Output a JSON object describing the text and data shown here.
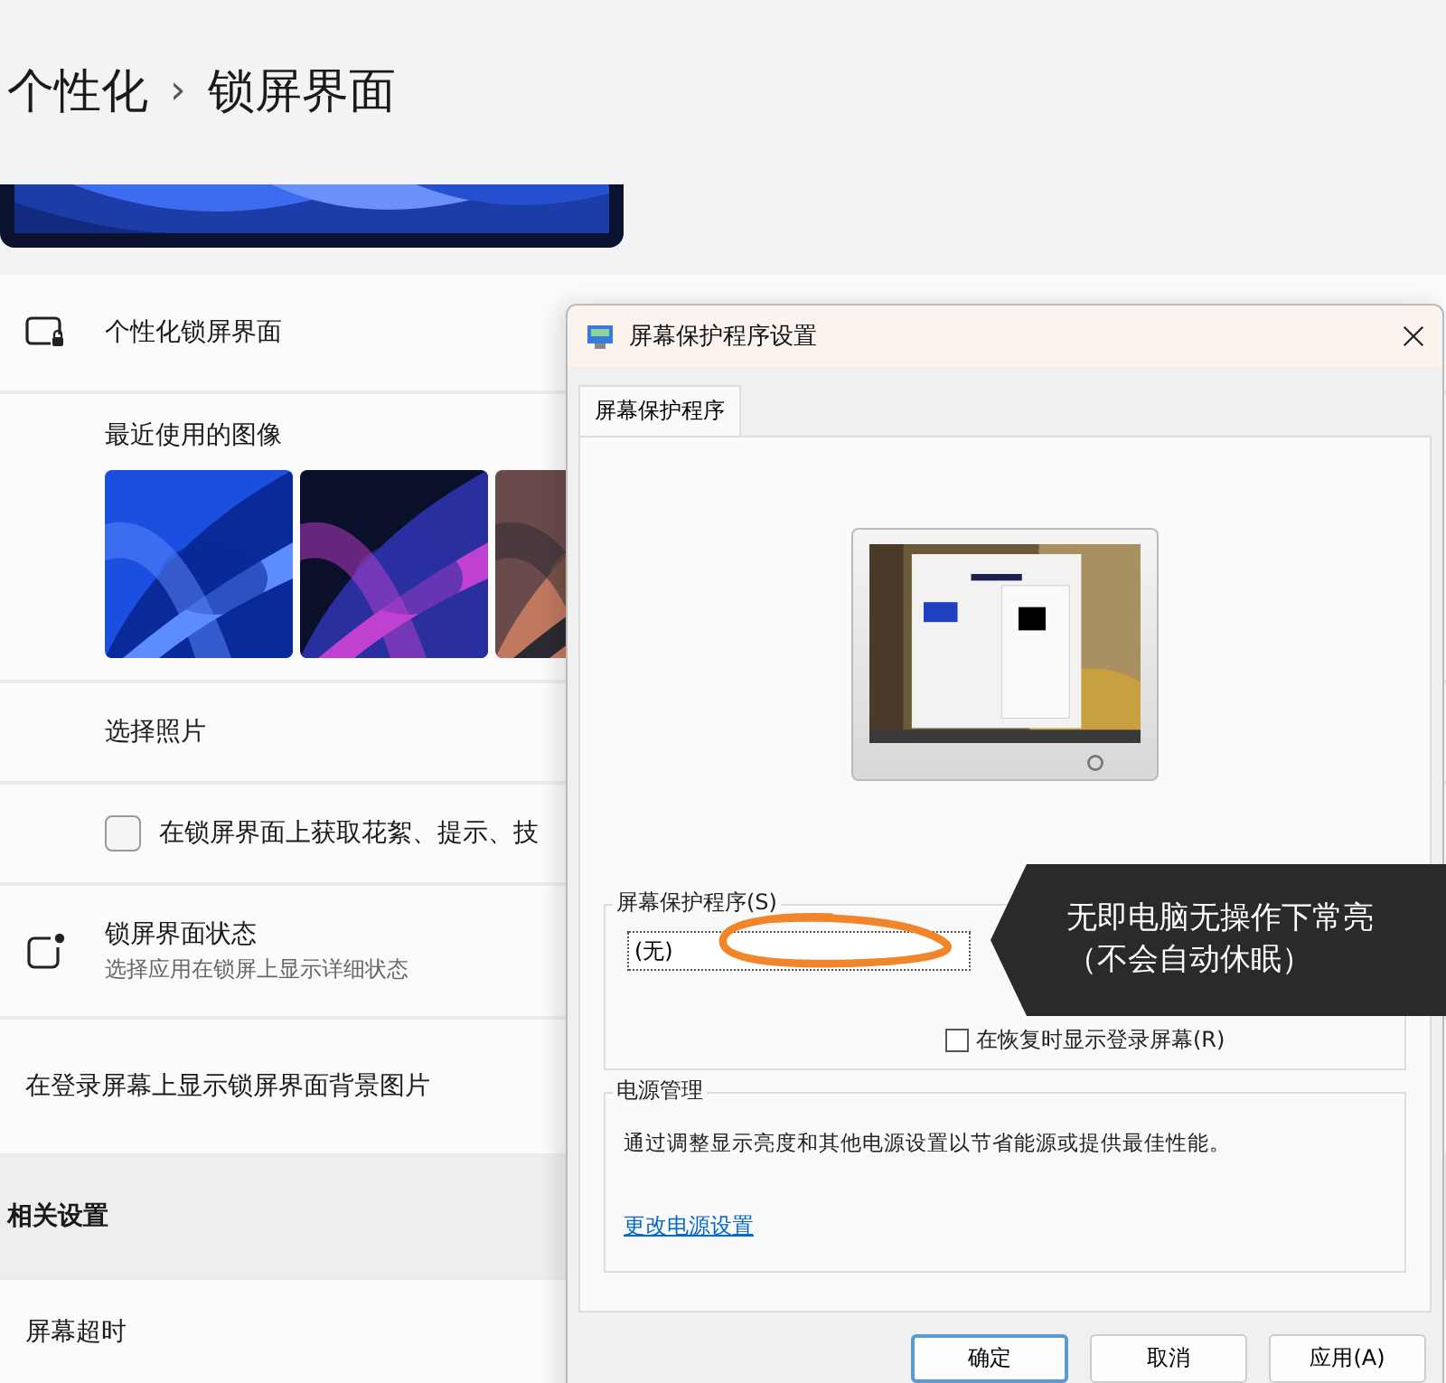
{
  "breadcrumb": {
    "parent": "个性化",
    "separator": "›",
    "current": "锁屏界面"
  },
  "rows": [
    {
      "kind": "lock",
      "label": "个性化锁屏界面"
    },
    {
      "kind": "recent",
      "label": "最近使用的图像"
    },
    {
      "kind": "plain",
      "label": "选择照片"
    },
    {
      "kind": "checkbox",
      "label": "在锁屏界面上获取花絮、提示、技",
      "checked": false
    },
    {
      "kind": "status",
      "label": "锁屏界面状态",
      "description": "选择应用在锁屏上显示详细状态"
    },
    {
      "kind": "plain",
      "label": "在登录屏幕上显示锁屏界面背景图片"
    },
    {
      "kind": "section",
      "label": "相关设置"
    },
    {
      "kind": "plain",
      "label": "屏幕超时"
    }
  ],
  "dialog": {
    "title": "屏幕保护程序设置",
    "tab": {
      "label": "屏幕保护程序",
      "selected": true
    },
    "screensaver_group": {
      "label": "屏幕保护程序(S)",
      "value": "(无)"
    },
    "resume_checkbox": {
      "label": "在恢复时显示登录屏幕(R)",
      "checked": false
    },
    "power_group": {
      "label": "电源管理",
      "description": "通过调整显示亮度和其他电源设置以节省能源或提供最佳性能。",
      "link": "更改电源设置"
    },
    "buttons": [
      {
        "label": "确定",
        "default": true
      },
      {
        "label": "取消",
        "default": false
      },
      {
        "label": "应用(A)",
        "default": false
      }
    ]
  },
  "callout": {
    "text": "无即电脑无操作下常亮（不会自动休眠）"
  }
}
